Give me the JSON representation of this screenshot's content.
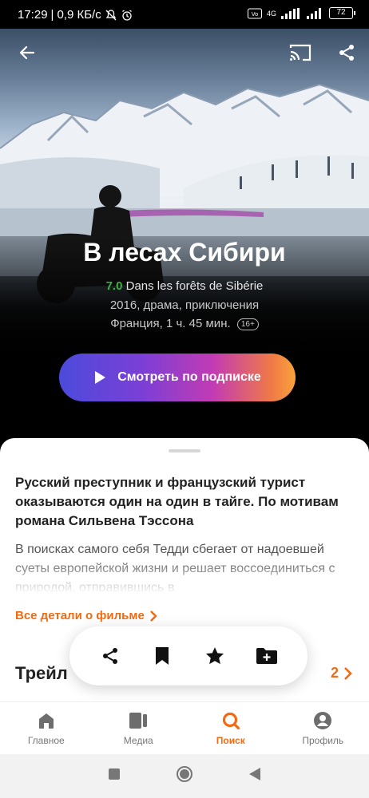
{
  "status_bar": {
    "time": "17:29",
    "speed": "0,9 КБ/с",
    "battery": "72",
    "network": "4G"
  },
  "hero": {
    "title": "В лесах Сибири",
    "rating": "7.0",
    "original_title": "Dans les forêts de Sibérie",
    "year_genres": "2016, драма, приключения",
    "country_duration": "Франция, 1 ч. 45 мин.",
    "age_rating": "16+",
    "watch_button_label": "Смотреть по подписке"
  },
  "sheet": {
    "lead": "Русский преступник и французский турист оказываются один на один в тайге. По мотивам романа Сильвена Тэссона",
    "description": "В поисках самого себя Тедди сбегает от надоевшей суеты европейской жизни и решает воссоединиться с природой, отправившись в",
    "details_link": "Все детали о фильме",
    "trailers_title": "Трейл",
    "trailers_count": "2"
  },
  "tabs": [
    {
      "label": "Главное",
      "icon": "home-icon"
    },
    {
      "label": "Медиа",
      "icon": "media-icon"
    },
    {
      "label": "Поиск",
      "icon": "search-icon"
    },
    {
      "label": "Профиль",
      "icon": "profile-icon"
    }
  ],
  "colors": {
    "accent": "#f36a10",
    "rating": "#3bb33b"
  }
}
